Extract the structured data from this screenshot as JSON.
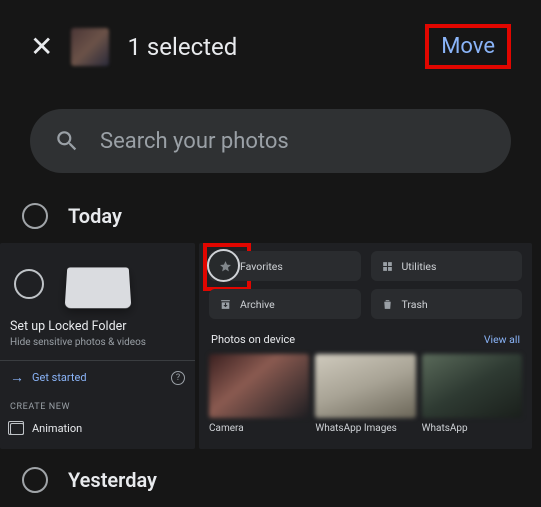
{
  "header": {
    "selection_title": "1 selected",
    "move_label": "Move"
  },
  "search": {
    "placeholder": "Search your photos"
  },
  "sections": {
    "today": "Today",
    "yesterday": "Yesterday"
  },
  "locked_folder_card": {
    "title": "Set up Locked Folder",
    "subtitle": "Hide sensitive photos & videos",
    "get_started": "Get started",
    "create_new_label": "CREATE NEW",
    "animation": "Animation"
  },
  "library_card": {
    "chips": {
      "favorites": "Favorites",
      "utilities": "Utilities",
      "archive": "Archive",
      "trash": "Trash"
    },
    "photos_on_device": "Photos on device",
    "view_all": "View all",
    "albums": [
      "Camera",
      "WhatsApp Images",
      "WhatsApp"
    ]
  }
}
